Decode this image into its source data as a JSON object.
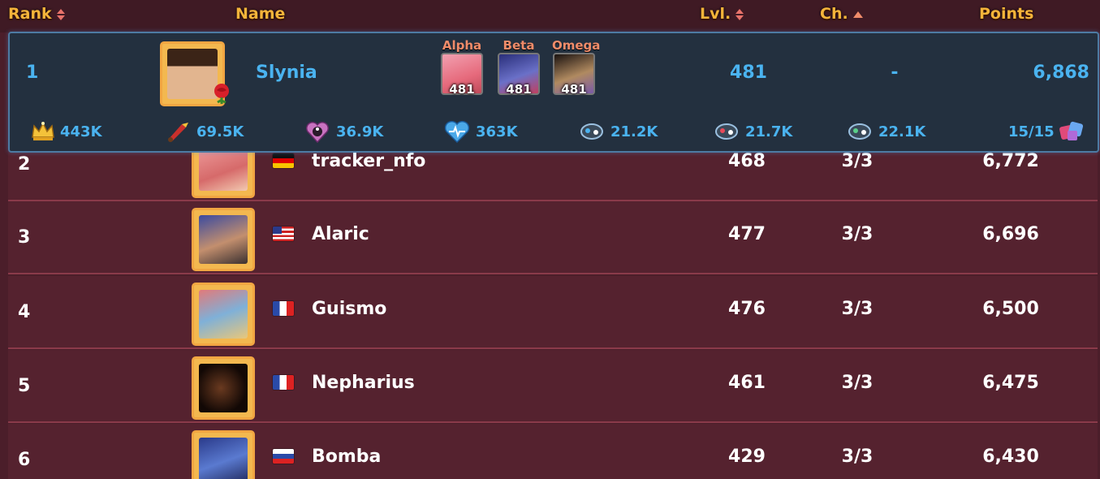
{
  "header": {
    "rank_label": "Rank",
    "name_label": "Name",
    "level_label": "Lvl.",
    "challenges_label": "Ch.",
    "points_label": "Points"
  },
  "featured": {
    "rank": "1",
    "name": "Slynia",
    "level": "481",
    "challenges": "-",
    "points": "6,868",
    "team": [
      {
        "label": "Alpha",
        "level": "481",
        "color": "#e66a7c"
      },
      {
        "label": "Beta",
        "level": "481",
        "color": "#3a3f8f"
      },
      {
        "label": "Omega",
        "level": "481",
        "color": "#7a5a3a"
      }
    ],
    "stats": [
      {
        "icon": "crown-icon",
        "value": "443K"
      },
      {
        "icon": "brush-icon",
        "value": "69.5K"
      },
      {
        "icon": "yin-yang-heart-icon",
        "value": "36.9K"
      },
      {
        "icon": "heartbeat-icon",
        "value": "363K"
      },
      {
        "icon": "attack-skill-icon",
        "value": "21.2K"
      },
      {
        "icon": "defense-skill-icon",
        "value": "21.7K"
      },
      {
        "icon": "harmony-skill-icon",
        "value": "22.1K"
      },
      {
        "icon": "gems-icon",
        "value": "15/15"
      }
    ]
  },
  "rows": [
    {
      "rank": "2",
      "name": "tracker_nfo",
      "flag": "germany",
      "level": "468",
      "challenges": "3/3",
      "points": "6,772"
    },
    {
      "rank": "3",
      "name": "Alaric",
      "flag": "usa",
      "level": "477",
      "challenges": "3/3",
      "points": "6,696"
    },
    {
      "rank": "4",
      "name": "Guismo",
      "flag": "france",
      "level": "476",
      "challenges": "3/3",
      "points": "6,500"
    },
    {
      "rank": "5",
      "name": "Nepharius",
      "flag": "france",
      "level": "461",
      "challenges": "3/3",
      "points": "6,475"
    },
    {
      "rank": "6",
      "name": "Bomba",
      "flag": "russia",
      "level": "429",
      "challenges": "3/3",
      "points": "6,430"
    }
  ],
  "colors": {
    "accent_blue": "#4ab3f0",
    "header_gold": "#f4b43a",
    "row_bg": "#55222f",
    "featured_bg": "#23303f"
  }
}
